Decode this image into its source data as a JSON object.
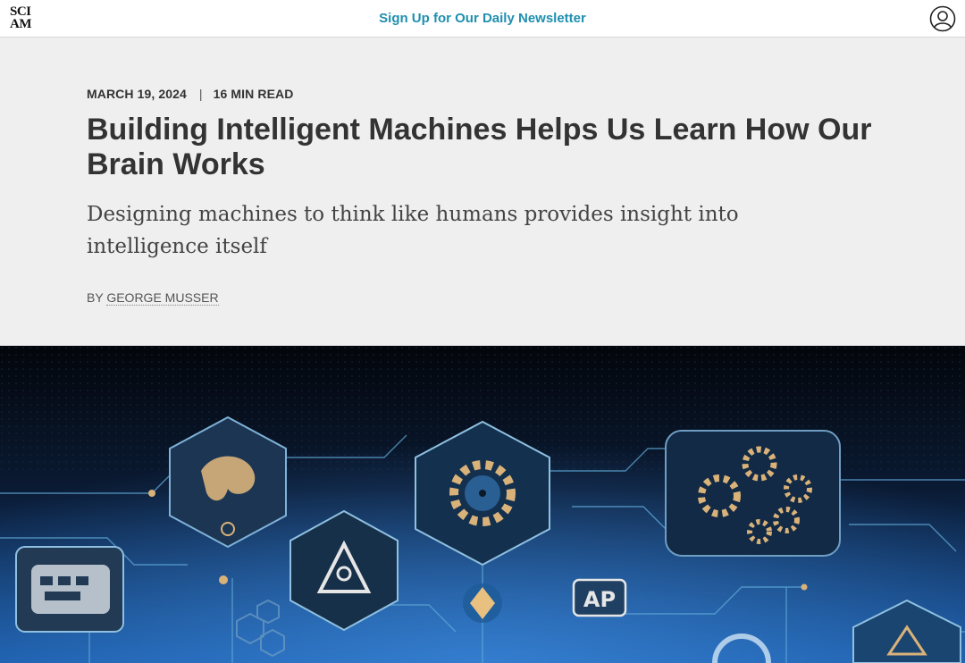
{
  "topbar": {
    "logo_line1": "SCI",
    "logo_line2": "AM",
    "newsletter_label": "Sign Up for Our Daily Newsletter",
    "account_icon": "user-account-icon"
  },
  "article": {
    "date": "MARCH 19, 2024",
    "separator": "|",
    "read_time": "16 MIN READ",
    "title": "Building Intelligent Machines Helps Us Learn How Our Brain Works",
    "subtitle": "Designing machines to think like humans provides insight into intelligence itself",
    "byline_prefix": "BY",
    "author": "GEORGE MUSSER"
  },
  "hero_image": {
    "chip_label": "AP"
  },
  "colors": {
    "accent": "#1f8fb0",
    "header_bg": "#efefef",
    "title": "#333333"
  }
}
